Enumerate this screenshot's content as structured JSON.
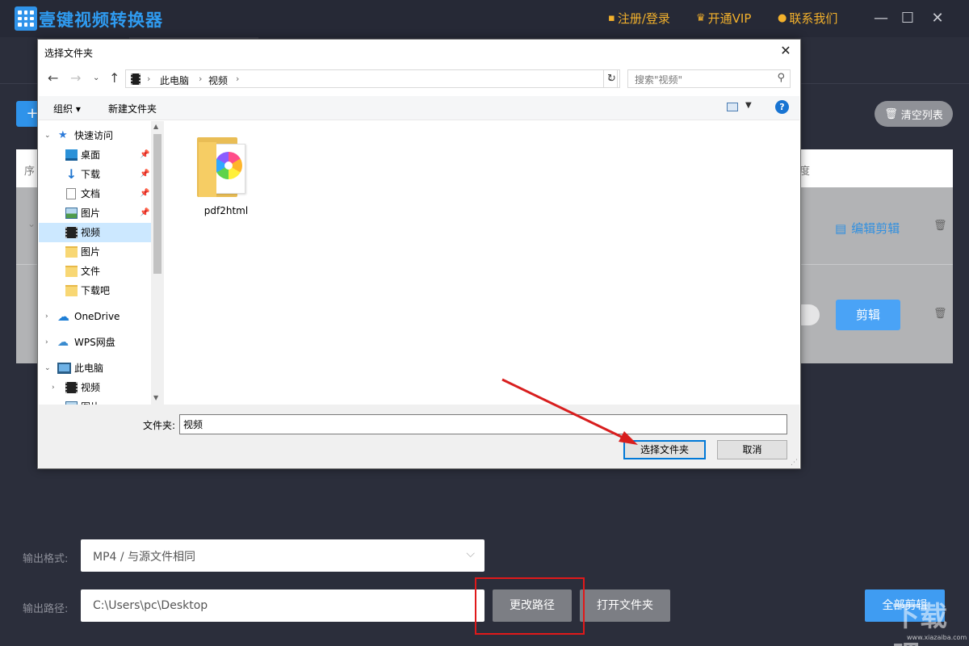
{
  "app": {
    "title": "壹键视频转换器",
    "links": {
      "register": "注册/登录",
      "vip": "开通VIP",
      "contact": "联系我们"
    }
  },
  "toolbar": {
    "add": "+",
    "clear": "清空列表"
  },
  "table": {
    "col_index": "序",
    "col_progress": "度",
    "rows": [
      {
        "action_label": "编辑剪辑"
      },
      {
        "action_label": "剪辑"
      }
    ]
  },
  "settings": {
    "format_label": "输出格式:",
    "format_value": "MP4 / 与源文件相同",
    "path_label": "输出路径:",
    "path_value": "C:\\Users\\pc\\Desktop",
    "change_path": "更改路径",
    "open_folder": "打开文件夹",
    "cut_all": "全部剪辑"
  },
  "watermark": {
    "glyphs": "下载吧",
    "url": "www.xiazaiba.com"
  },
  "dialog": {
    "title": "选择文件夹",
    "breadcrumb": [
      "此电脑",
      "视频"
    ],
    "search_placeholder": "搜索\"视频\"",
    "organize": "组织 ▾",
    "new_folder": "新建文件夹",
    "nav": {
      "quick_access": "快速访问",
      "desktop": "桌面",
      "downloads": "下载",
      "documents": "文档",
      "pictures": "图片",
      "videos": "视频",
      "pictures2": "图片",
      "files": "文件",
      "xiazaiba": "下载吧",
      "onedrive": "OneDrive",
      "wps": "WPS网盘",
      "this_pc": "此电脑",
      "pc_videos": "视频",
      "pc_pictures": "图片"
    },
    "items": [
      {
        "name": "pdf2html"
      }
    ],
    "folder_label": "文件夹:",
    "folder_value": "视频",
    "select_button": "选择文件夹",
    "cancel_button": "取消"
  },
  "colors": {
    "accent": "#2f93ea",
    "vip": "#f3b12c",
    "highlight": "#e0191a",
    "selection": "#cce8ff"
  }
}
